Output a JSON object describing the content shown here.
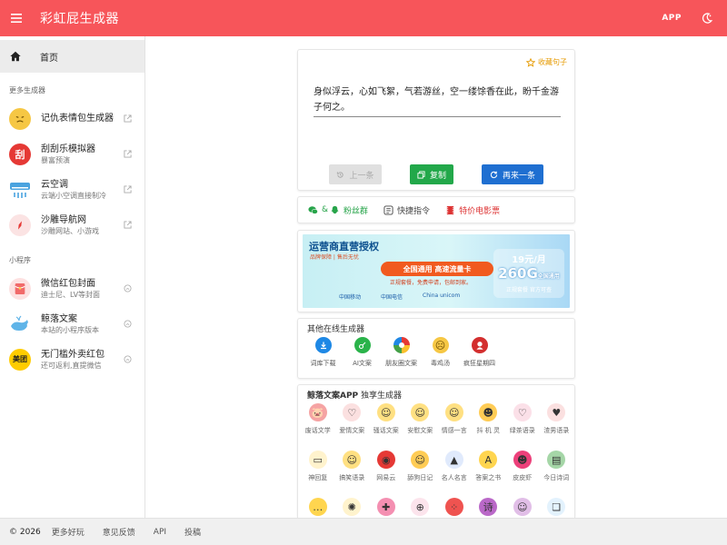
{
  "header": {
    "title": "彩虹屁生成器",
    "app_label": "APP",
    "bg_color": "#f7555a"
  },
  "sidebar": {
    "home_label": "首页",
    "section_more": "更多生成器",
    "more_items": [
      {
        "name": "记仇表情包生成器",
        "sub": "",
        "icon": "grumpy-face-icon",
        "color": "#f6c744"
      },
      {
        "name": "刮刮乐模拟器",
        "sub": "暴富预演",
        "icon": "scratch-card-icon",
        "color": "#e53935",
        "glyph": "刮"
      },
      {
        "name": "云空调",
        "sub": "云端小空调直接制冷",
        "icon": "air-conditioner-icon",
        "color": "#4aa3df"
      },
      {
        "name": "沙雕导航网",
        "sub": "沙雕网站、小游戏",
        "icon": "compass-icon",
        "color": "#f4a7a7"
      }
    ],
    "section_mini": "小程序",
    "mini_items": [
      {
        "name": "微信红包封面",
        "sub": "迪士尼、LV等封面",
        "icon": "red-packet-icon",
        "color": "#f3a6a6"
      },
      {
        "name": "鲸落文案",
        "sub": "本站的小程序版本",
        "icon": "whale-icon",
        "color": "#5fb4e8"
      },
      {
        "name": "无门槛外卖红包",
        "sub": "还可返利,直提微信",
        "icon": "meituan-icon",
        "color": "#ffcc00",
        "glyph": "美团"
      }
    ]
  },
  "quote": {
    "collect_label": "收藏句子",
    "text": "身似浮云，心如飞絮，气若游丝，空一缕馀香在此，盼千金游子何之。",
    "prev_label": "上一条",
    "copy_label": "复制",
    "next_label": "再来一条"
  },
  "links": {
    "fans": "粉丝群",
    "fans_prefix": "&",
    "shortcut": "快捷指令",
    "movie": "特价电影票"
  },
  "banner": {
    "title": "运营商直营授权",
    "sub": "品牌保障 | 售后无忧",
    "pill": "全国通用 高速流量卡",
    "pill_sub": "正规套餐，免费申请，包邮到家。",
    "logos": [
      "中国移动",
      "中国电信",
      "China unicom"
    ],
    "price_month": "19元/月",
    "price_data": "260G",
    "price_data_suffix": "全国通用",
    "price_note": "正规套餐 官方可查"
  },
  "other_gens": {
    "title": "其他在线生成器",
    "items": [
      {
        "label": "词库下载",
        "icon": "download-icon",
        "color": "#1e88e5"
      },
      {
        "label": "AI文案",
        "icon": "ai-icon",
        "color": "#2ab34a"
      },
      {
        "label": "朋友圈文案",
        "icon": "pinwheel-icon",
        "color": "#f4a30b"
      },
      {
        "label": "毒鸡汤",
        "icon": "emoji-icon",
        "color": "#f6c744"
      },
      {
        "label": "疯狂星期四",
        "icon": "kfc-icon",
        "color": "#d32f2f"
      }
    ]
  },
  "app_gens": {
    "title_bold": "鲸落文案APP",
    "title_rest": " 独享生成器",
    "items": [
      {
        "label": "废话文学",
        "icon": "pig-icon",
        "color": "#f5a3a3",
        "glyph": "🐷"
      },
      {
        "label": "爱情文案",
        "icon": "heart-hand-icon",
        "color": "#fbe0e0",
        "glyph": "♡"
      },
      {
        "label": "骚话文案",
        "icon": "star-eyes-icon",
        "color": "#ffe082",
        "glyph": "☺"
      },
      {
        "label": "安慰文案",
        "icon": "smirk-icon",
        "color": "#ffe082",
        "glyph": "☺"
      },
      {
        "label": "情感一言",
        "icon": "thinking-icon",
        "color": "#ffe082",
        "glyph": "☺"
      },
      {
        "label": "抖 机 灵",
        "icon": "cool-icon",
        "color": "#ffcc55",
        "glyph": "☻"
      },
      {
        "label": "绿茶语录",
        "icon": "broken-heart-icon",
        "color": "#fbe0e8",
        "glyph": "♡"
      },
      {
        "label": "渣男语录",
        "icon": "heartbeat-icon",
        "color": "#fbe0e0",
        "glyph": "♥"
      },
      {
        "label": "神回复",
        "icon": "chat-icon",
        "color": "#fff3cd",
        "glyph": "▭"
      },
      {
        "label": "搞笑语录",
        "icon": "laugh-icon",
        "color": "#ffe082",
        "glyph": "☺"
      },
      {
        "label": "网易云",
        "icon": "netease-icon",
        "color": "#e53935",
        "glyph": "◉"
      },
      {
        "label": "舔狗日记",
        "icon": "tongue-icon",
        "color": "#ffcc55",
        "glyph": "☺"
      },
      {
        "label": "名人名言",
        "icon": "graduation-cap-icon",
        "color": "#e0eafc",
        "glyph": "▲"
      },
      {
        "label": "答案之书",
        "icon": "answer-book-icon",
        "color": "#ffd54f",
        "glyph": "A"
      },
      {
        "label": "皮皮虾",
        "icon": "shrimp-icon",
        "color": "#ec407a",
        "glyph": "☻"
      },
      {
        "label": "今日诗词",
        "icon": "poem-icon",
        "color": "#a5d6a7",
        "glyph": "▤"
      },
      {
        "label": "",
        "icon": "speech-dots-icon",
        "color": "#ffd54f",
        "glyph": "…"
      },
      {
        "label": "",
        "icon": "lightbulb-icon",
        "color": "#fff3cd",
        "glyph": "✺"
      },
      {
        "label": "",
        "icon": "bandage-icon",
        "color": "#f48fb1",
        "glyph": "✚"
      },
      {
        "label": "",
        "icon": "gamepad-icon",
        "color": "#fce4ec",
        "glyph": "⊕"
      },
      {
        "label": "",
        "icon": "dice-icon",
        "color": "#ef5350",
        "glyph": "⁘"
      },
      {
        "label": "",
        "icon": "poem-encyclopedia-icon",
        "color": "#ba68c8",
        "glyph": "诗"
      },
      {
        "label": "",
        "icon": "people-icon",
        "color": "#e1bee7",
        "glyph": "☺"
      },
      {
        "label": "",
        "icon": "message-bubble-icon",
        "color": "#e3f2fd",
        "glyph": "❏"
      }
    ]
  },
  "footer": {
    "copyright": "© 2026",
    "links": [
      "更多好玩",
      "意见反馈",
      "API",
      "投稿"
    ]
  }
}
